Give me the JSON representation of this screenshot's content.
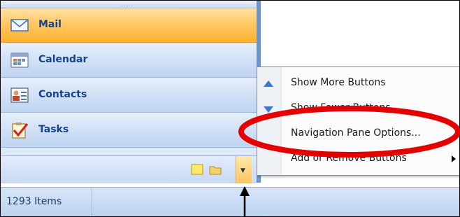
{
  "nav_pane": {
    "grip": ".....",
    "buttons": [
      {
        "label": "Mail",
        "icon": "mail-icon",
        "selected": true
      },
      {
        "label": "Calendar",
        "icon": "calendar-icon",
        "selected": false
      },
      {
        "label": "Contacts",
        "icon": "contacts-icon",
        "selected": false
      },
      {
        "label": "Tasks",
        "icon": "tasks-icon",
        "selected": false
      }
    ],
    "bottom_icons": [
      "notes-icon",
      "folder-icon"
    ],
    "configure_icon": "chevron-down-icon"
  },
  "status_bar": {
    "items_text": "1293 Items"
  },
  "context_menu": {
    "items": [
      {
        "label": "Show More Buttons",
        "icon": "arrow-up-icon"
      },
      {
        "label": "Show Fewer Buttons",
        "icon": "arrow-down-icon"
      },
      {
        "label": "Navigation Pane Options...",
        "icon": ""
      },
      {
        "label": "Add or Remove Buttons",
        "icon": "submenu-arrow-icon"
      }
    ]
  },
  "annotation": {
    "ellipse_color": "#e30000",
    "arrow_color": "#000000"
  },
  "colors": {
    "selected_bg": "#ffc865",
    "nav_bg": "#cfdff5",
    "label_text": "#15428b"
  }
}
